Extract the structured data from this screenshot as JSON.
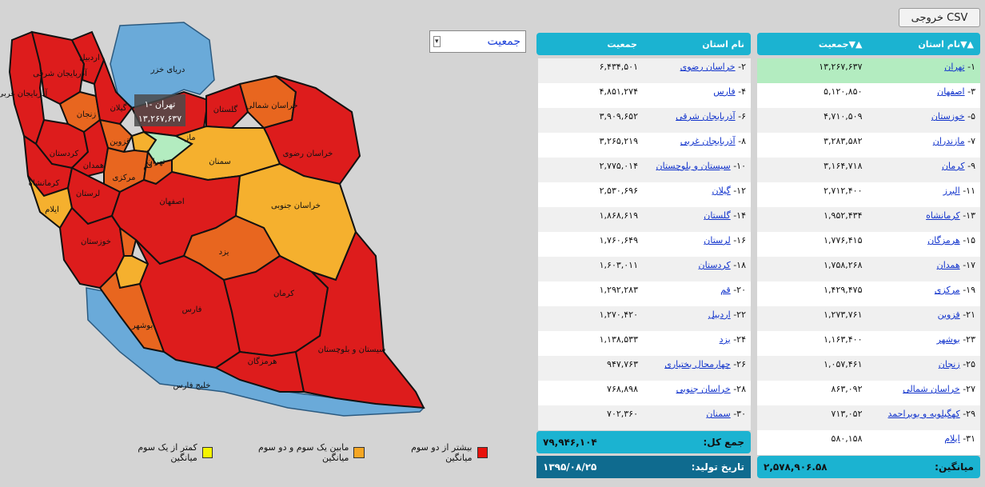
{
  "toolbar": {
    "csv_label": "خروجی CSV"
  },
  "selector": {
    "value": "جمعیت"
  },
  "map": {
    "caspian_label": "دریای خزر",
    "gulf_label": "خلیج فارس",
    "tooltip_line1": "۱- تهران",
    "tooltip_line2": "۱۳,۲۶۷,۶۳۷",
    "colors": {
      "high": "#dd1c1c",
      "mid": "#e8661f",
      "low": "#f5b02e",
      "sea": "#6aaad9"
    },
    "provinces": {
      "tehran": "تهران",
      "azar_sharghi": "آذربایجان شرقی",
      "azar_gharbi": "آذربایجان غربی",
      "ardabil": "اردبیل",
      "zanjan": "زنجان",
      "gilan": "گیلان",
      "qazvin": "قزوین",
      "mazandaran": "ماز",
      "golestan": "گلستان",
      "khorasan_shomali": "خراسان شمالی",
      "khorasan_razavi": "خراسان رضوی",
      "semnan": "سمنان",
      "kordestan": "کردستان",
      "hamedan": "همدان",
      "kermanshah": "کرمانشاه",
      "markazi": "مرکزی",
      "qom": "قم",
      "ilam": "ایلام",
      "lorestan": "لرستان",
      "isfahan": "اصفهان",
      "khuzestan": "خوزستان",
      "chaharmahal": "چهارمحال و بختیاری",
      "kohgiluyeh": "کهگیلویه و بویراحمد",
      "yazd": "یزد",
      "khorasan_jonobi": "خراسان جنوبی",
      "bushehr": "بوشهر",
      "fars": "فارس",
      "kerman": "کرمان",
      "hormozgan": "هرمزگان",
      "sistan": "سیستان و بلوچستان",
      "alborz": "البرز"
    }
  },
  "legend": {
    "high": "بیشتر از دو سوم میانگین",
    "mid": "مابین یک سوم و دو سوم میانگین",
    "low": "کمتر از یک سوم میانگین",
    "colors": {
      "high": "#e8120c",
      "mid": "#f5a623",
      "low": "#f5f500"
    }
  },
  "table": {
    "right_header": {
      "name": "▲▼نام استان",
      "pop": "▲▼جمعیت"
    },
    "left_header": {
      "name": "نام استان",
      "pop": "جمعیت"
    },
    "right_rows": [
      {
        "num": "۱-",
        "name": "تهران",
        "pop": "۱۳,۲۶۷,۶۳۷"
      },
      {
        "num": "۳-",
        "name": "اصفهان",
        "pop": "۵,۱۲۰,۸۵۰"
      },
      {
        "num": "۵-",
        "name": "خوزستان",
        "pop": "۴,۷۱۰,۵۰۹"
      },
      {
        "num": "۷-",
        "name": "مازندران",
        "pop": "۳,۲۸۳,۵۸۲"
      },
      {
        "num": "۹-",
        "name": "کرمان",
        "pop": "۳,۱۶۴,۷۱۸"
      },
      {
        "num": "۱۱-",
        "name": "البرز",
        "pop": "۲,۷۱۲,۴۰۰"
      },
      {
        "num": "۱۳-",
        "name": "کرمانشاه",
        "pop": "۱,۹۵۲,۴۳۴"
      },
      {
        "num": "۱۵-",
        "name": "هرمزگان",
        "pop": "۱,۷۷۶,۴۱۵"
      },
      {
        "num": "۱۷-",
        "name": "همدان",
        "pop": "۱,۷۵۸,۲۶۸"
      },
      {
        "num": "۱۹-",
        "name": "مرکزی",
        "pop": "۱,۴۲۹,۴۷۵"
      },
      {
        "num": "۲۱-",
        "name": "قزوین",
        "pop": "۱,۲۷۳,۷۶۱"
      },
      {
        "num": "۲۳-",
        "name": "بوشهر",
        "pop": "۱,۱۶۳,۴۰۰"
      },
      {
        "num": "۲۵-",
        "name": "زنجان",
        "pop": "۱,۰۵۷,۴۶۱"
      },
      {
        "num": "۲۷-",
        "name": "خراسان شمالی",
        "pop": "۸۶۳,۰۹۲"
      },
      {
        "num": "۲۹-",
        "name": "کهگیلویه و بویراحمد",
        "pop": "۷۱۳,۰۵۲"
      },
      {
        "num": "۳۱-",
        "name": "ایلام",
        "pop": "۵۸۰,۱۵۸"
      }
    ],
    "left_rows": [
      {
        "num": "۲-",
        "name": "خراسان رضوی",
        "pop": "۶,۴۳۴,۵۰۱"
      },
      {
        "num": "۴-",
        "name": "فارس",
        "pop": "۴,۸۵۱,۲۷۴"
      },
      {
        "num": "۶-",
        "name": "آذربایجان شرقی",
        "pop": "۳,۹۰۹,۶۵۲"
      },
      {
        "num": "۸-",
        "name": "آذربایجان غربی",
        "pop": "۳,۲۶۵,۲۱۹"
      },
      {
        "num": "۱۰-",
        "name": "سیستان و بلوچستان",
        "pop": "۲,۷۷۵,۰۱۴"
      },
      {
        "num": "۱۲-",
        "name": "گیلان",
        "pop": "۲,۵۳۰,۶۹۶"
      },
      {
        "num": "۱۴-",
        "name": "گلستان",
        "pop": "۱,۸۶۸,۶۱۹"
      },
      {
        "num": "۱۶-",
        "name": "لرستان",
        "pop": "۱,۷۶۰,۶۴۹"
      },
      {
        "num": "۱۸-",
        "name": "کردستان",
        "pop": "۱,۶۰۳,۰۱۱"
      },
      {
        "num": "۲۰-",
        "name": "قم",
        "pop": "۱,۲۹۲,۲۸۳"
      },
      {
        "num": "۲۲-",
        "name": "اردبیل",
        "pop": "۱,۲۷۰,۴۲۰"
      },
      {
        "num": "۲۴-",
        "name": "یزد",
        "pop": "۱,۱۳۸,۵۳۳"
      },
      {
        "num": "۲۶-",
        "name": "چهارمحال بختیاری",
        "pop": "۹۴۷,۷۶۳"
      },
      {
        "num": "۲۸-",
        "name": "خراسان جنوبی",
        "pop": "۷۶۸,۸۹۸"
      },
      {
        "num": "۳۰-",
        "name": "سمنان",
        "pop": "۷۰۲,۳۶۰"
      }
    ],
    "total_label": "جمع کل:",
    "total_value": "۷۹,۹۴۶,۱۰۴",
    "date_label": "تاریخ تولید:",
    "date_value": "۱۳۹۵/۰۸/۲۵",
    "avg_label": "میانگین:",
    "avg_value": "۲,۵۷۸,۹۰۶.۵۸"
  }
}
